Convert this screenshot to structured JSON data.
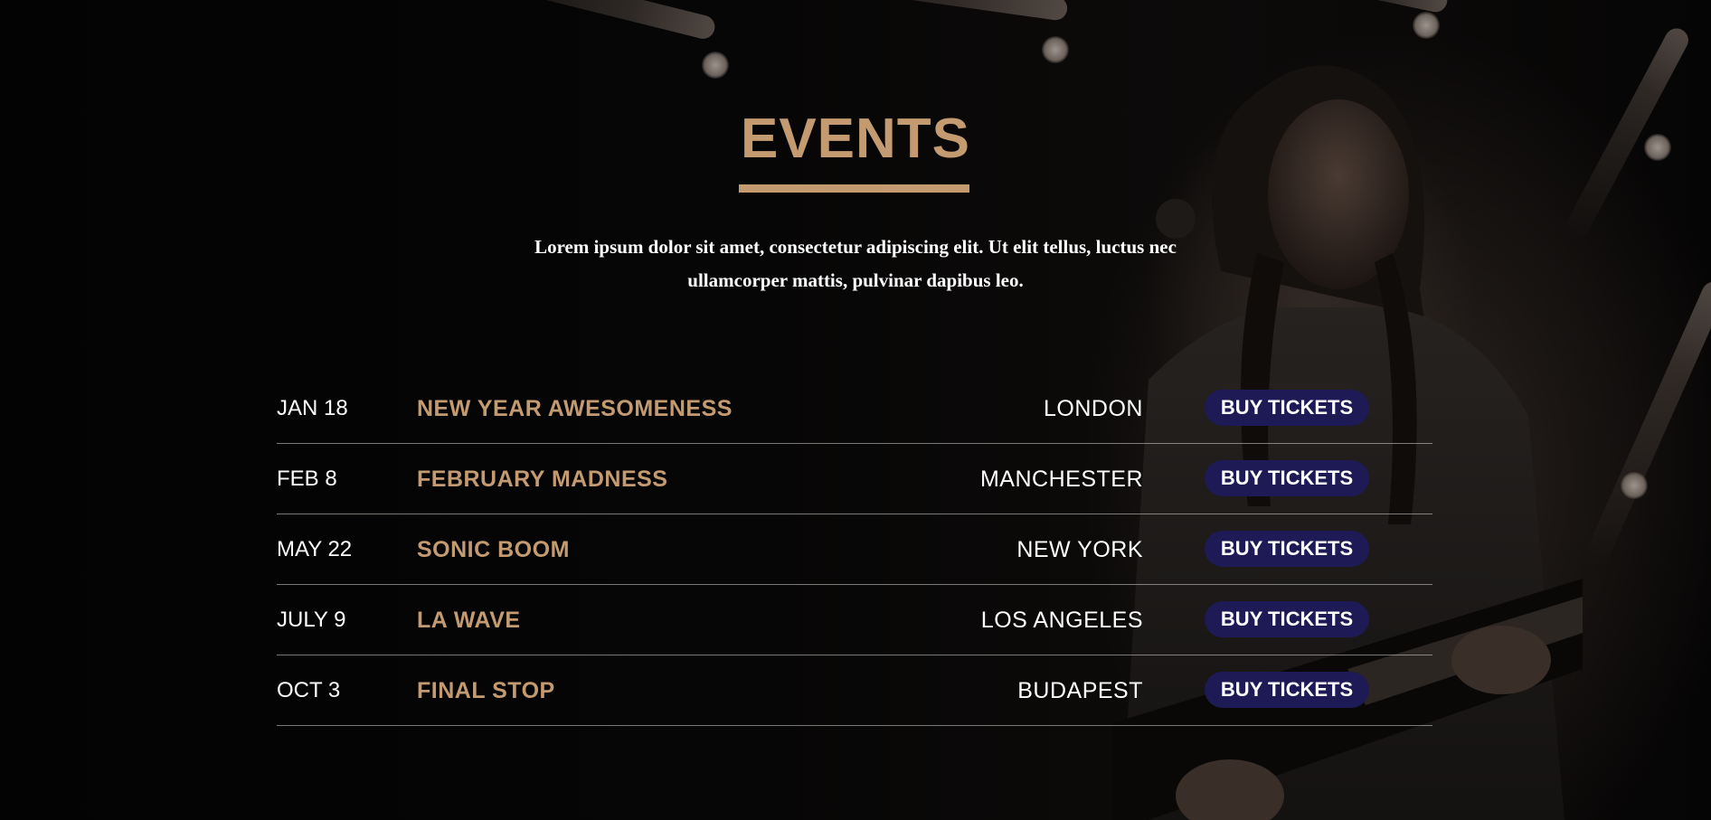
{
  "section": {
    "title": "EVENTS",
    "intro": "Lorem ipsum dolor sit amet, consectetur adipiscing elit. Ut elit tellus, luctus nec ullamcorper mattis, pulvinar dapibus leo."
  },
  "events": [
    {
      "date": "JAN 18",
      "name": "NEW YEAR AWESOMENESS",
      "city": "LONDON",
      "button": "BUY TICKETS"
    },
    {
      "date": "FEB 8",
      "name": "FEBRUARY MADNESS",
      "city": "MANCHESTER",
      "button": "BUY TICKETS"
    },
    {
      "date": "MAY 22",
      "name": "SONIC BOOM",
      "city": "NEW YORK",
      "button": "BUY TICKETS"
    },
    {
      "date": "JULY 9",
      "name": "LA WAVE",
      "city": "LOS ANGELES",
      "button": "BUY TICKETS"
    },
    {
      "date": "OCT 3",
      "name": "FINAL STOP",
      "city": "BUDAPEST",
      "button": "BUY TICKETS"
    }
  ],
  "colors": {
    "accent": "#c49b71",
    "button": "#1e1a55",
    "background": "#050404",
    "text": "#ffffff"
  },
  "background_image": "concert-guitarist-photo"
}
